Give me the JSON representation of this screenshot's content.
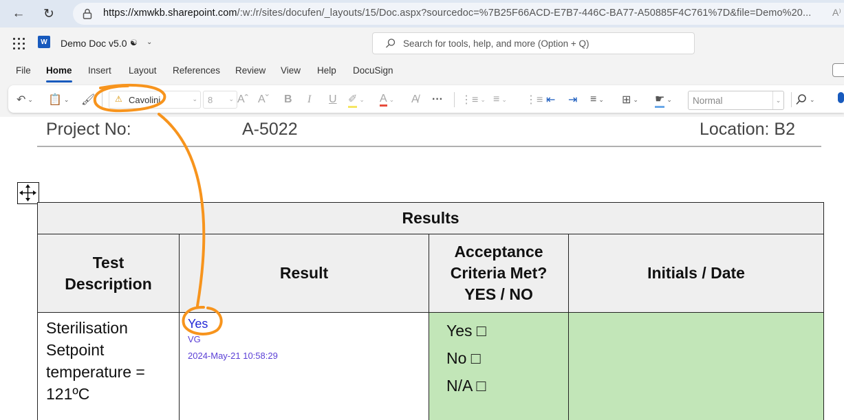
{
  "browser": {
    "url_domain": "https://xmwkb.sharepoint.com",
    "url_path": "/:w:/r/sites/docufen/_layouts/15/Doc.aspx?sourcedoc=%7B25F66ACD-E7B7-446C-BA77-A50885F4C761%7D&file=Demo%20..."
  },
  "app": {
    "doc_title": "Demo Doc v5.0",
    "search_placeholder": "Search for tools, help, and more (Option + Q)"
  },
  "ribbon": {
    "tabs": [
      "File",
      "Home",
      "Insert",
      "Layout",
      "References",
      "Review",
      "View",
      "Help",
      "DocuSign"
    ],
    "active_tab": "Home",
    "font_name": "Cavolini",
    "font_size": "8",
    "style": "Normal",
    "bold_label": "B",
    "italic_label": "I",
    "underline_label": "U",
    "more_label": "···"
  },
  "document": {
    "project_label": "Project No:",
    "project_value": "A-5022",
    "location": "Location: B2",
    "table": {
      "title": "Results",
      "headers": [
        "Test Description",
        "Result",
        "Acceptance Criteria Met? YES / NO",
        "Initials / Date"
      ],
      "row": {
        "description": "Sterilisation Setpoint temperature = 121ºC",
        "result_value": "Yes",
        "result_initials": "VG",
        "result_timestamp": "2024-May-21 10:58:29",
        "options": [
          "Yes □",
          "No □",
          "N/A □"
        ]
      }
    }
  },
  "colors": {
    "annotation": "#f7941d",
    "accent": "#185abd",
    "green_cell": "#c2e6b8",
    "result_blue": "#2329d6"
  }
}
